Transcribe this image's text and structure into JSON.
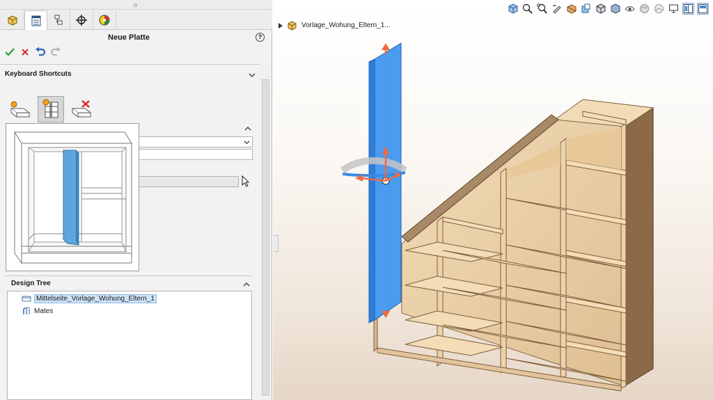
{
  "panel": {
    "tabs": [
      "feature-manager",
      "property-manager",
      "configuration-manager",
      "dimxpert-manager",
      "display-manager"
    ],
    "title": "Neue Platte",
    "help": "?",
    "actions": [
      "ok",
      "cancel",
      "undo",
      "redo"
    ],
    "groups": {
      "keyboard_shortcuts": "Keyboard Shortcuts",
      "design_tree": "Design Tree"
    },
    "design_tree": {
      "items": [
        {
          "label": "Mittelseite_Vorlage_Wohung_Eltern_1",
          "icon": "part-icon",
          "selected": true
        },
        {
          "label": "Mates",
          "icon": "mates-icon",
          "selected": false
        }
      ]
    }
  },
  "graphics": {
    "tree_root": "Vorlage_Wohung_Eltern_1...",
    "toolbar_icons": [
      "view-orientation-icon",
      "zoom-to-fit-icon",
      "zoom-area-icon",
      "previous-view-icon",
      "section-view-icon",
      "dynamic-annotation-icon",
      "view-orientation-icon",
      "display-style-icon",
      "hide-show-icon",
      "edit-appearance-icon",
      "apply-scene-icon",
      "view-settings-icon",
      "tile-horizontal-icon",
      "tile-vertical-icon"
    ]
  },
  "colors": {
    "accent": "#3b8be0",
    "wood": "#e9cfa7",
    "wood_edge": "#a57f54",
    "selection": "#3f8fe8"
  }
}
